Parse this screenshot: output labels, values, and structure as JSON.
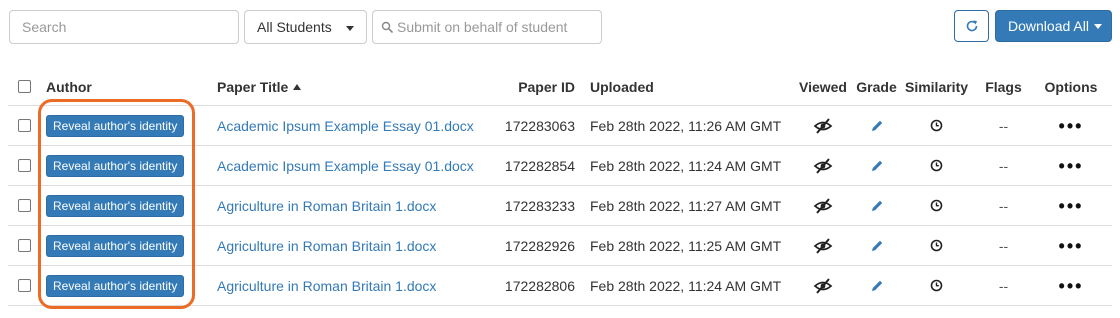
{
  "toolbar": {
    "search_placeholder": "Search",
    "student_filter": "All Students",
    "behalf_placeholder": "Submit on behalf of student",
    "download_label": "Download All"
  },
  "table": {
    "headers": {
      "author": "Author",
      "title": "Paper Title",
      "id": "Paper ID",
      "uploaded": "Uploaded",
      "viewed": "Viewed",
      "grade": "Grade",
      "similarity": "Similarity",
      "flags": "Flags",
      "options": "Options"
    },
    "rows": [
      {
        "author_btn": "Reveal author's identity",
        "title": "Academic Ipsum Example Essay 01.docx",
        "paper_id": "172283063",
        "uploaded": "Feb 28th 2022, 11:26 AM GMT",
        "flags": "--"
      },
      {
        "author_btn": "Reveal author's identity",
        "title": "Academic Ipsum Example Essay 01.docx",
        "paper_id": "172282854",
        "uploaded": "Feb 28th 2022, 11:24 AM GMT",
        "flags": "--"
      },
      {
        "author_btn": "Reveal author's identity",
        "title": "Agriculture in Roman Britain 1.docx",
        "paper_id": "172283233",
        "uploaded": "Feb 28th 2022, 11:27 AM GMT",
        "flags": "--"
      },
      {
        "author_btn": "Reveal author's identity",
        "title": "Agriculture in Roman Britain 1.docx",
        "paper_id": "172282926",
        "uploaded": "Feb 28th 2022, 11:25 AM GMT",
        "flags": "--"
      },
      {
        "author_btn": "Reveal author's identity",
        "title": "Agriculture in Roman Britain 1.docx",
        "paper_id": "172282806",
        "uploaded": "Feb 28th 2022, 11:24 AM GMT",
        "flags": "--"
      }
    ]
  },
  "icons": {
    "refresh": "refresh-icon",
    "viewed": "eye-slash-icon",
    "grade": "pencil-icon",
    "similarity": "clock-icon",
    "options": "ellipsis-icon"
  },
  "colors": {
    "primary": "#337ab7",
    "highlight": "#ec6b25"
  }
}
